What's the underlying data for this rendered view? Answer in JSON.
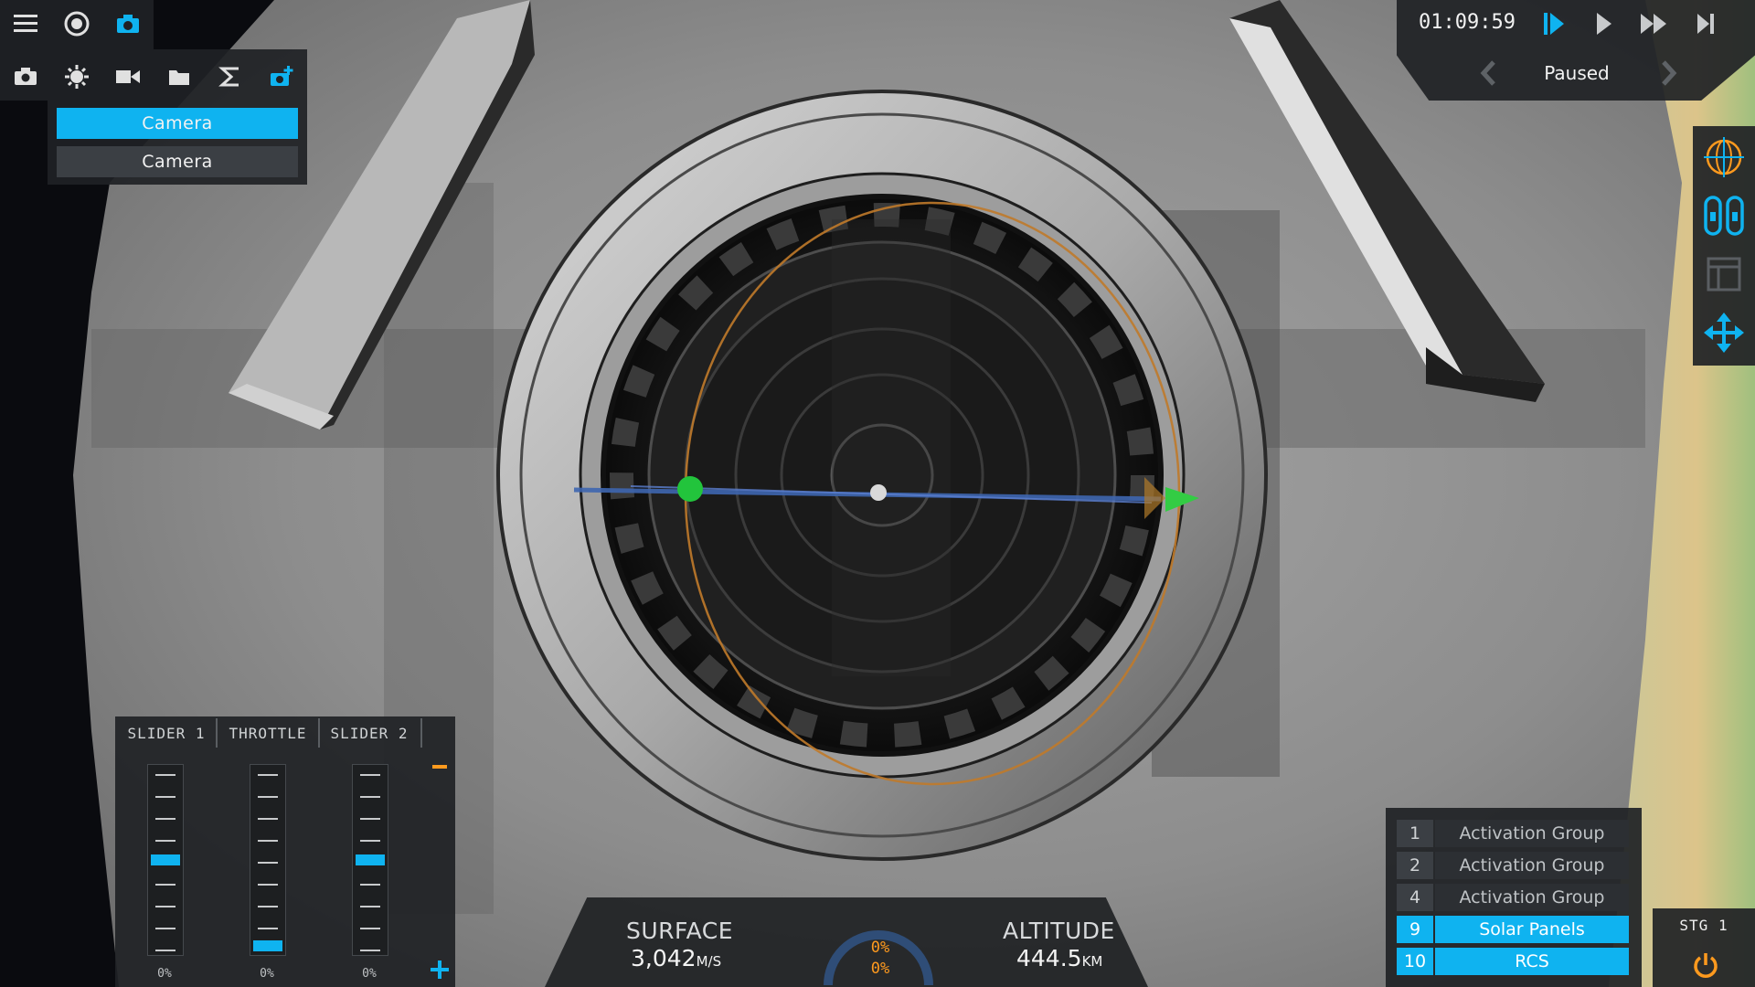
{
  "app": {
    "accent_color": "#0fb3f0",
    "warning_color": "#ff9a1e"
  },
  "toolbar_top": {
    "icons": [
      "menu-icon",
      "orbit-map-icon",
      "camera-icon"
    ]
  },
  "camera_toolbar": {
    "icons": [
      "screenshot-icon",
      "settings-sun-icon",
      "video-camera-icon",
      "folder-icon",
      "sigma-icon",
      "add-camera-icon"
    ]
  },
  "camera_menu": {
    "options": [
      "Camera",
      "Camera"
    ],
    "selected_index": 0
  },
  "time_controls": {
    "mission_time": "01:09:59",
    "status": "Paused",
    "buttons": [
      "pause-play-icon",
      "play-icon",
      "fast-forward-icon",
      "skip-end-icon"
    ],
    "prev_icon": "chevron-left-icon",
    "next_icon": "chevron-right-icon"
  },
  "right_tools": {
    "icons": [
      "center-of-mass-icon",
      "symmetry-icon",
      "panel-layout-icon",
      "move-arrows-icon"
    ]
  },
  "sliders": {
    "columns": [
      {
        "label": "SLIDER 1",
        "value_text": "0%",
        "level": 0.5
      },
      {
        "label": "THROTTLE",
        "value_text": "0%",
        "level": 0.0
      },
      {
        "label": "SLIDER 2",
        "value_text": "0%",
        "level": 0.5
      }
    ],
    "minus_icon": "minus-icon",
    "plus_icon": "plus-icon"
  },
  "flight_data": {
    "surface_label": "SURFACE",
    "surface_value": "3,042",
    "surface_unit": "M/S",
    "altitude_label": "ALTITUDE",
    "altitude_value": "444.5",
    "altitude_unit": "KM",
    "gauge_top": "0%",
    "gauge_bottom": "0%"
  },
  "activation_groups": [
    {
      "number": "1",
      "label": "Activation Group",
      "active": false
    },
    {
      "number": "2",
      "label": "Activation Group",
      "active": false
    },
    {
      "number": "4",
      "label": "Activation Group",
      "active": false
    },
    {
      "number": "9",
      "label": "Solar Panels",
      "active": true
    },
    {
      "number": "10",
      "label": "RCS",
      "active": true
    }
  ],
  "stage": {
    "label": "STG 1",
    "icon": "power-icon"
  }
}
